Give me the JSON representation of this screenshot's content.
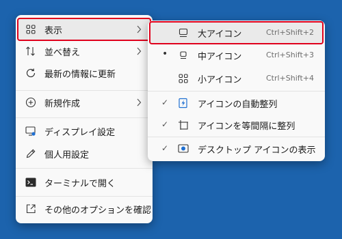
{
  "main_menu": {
    "items": [
      {
        "label": "表示",
        "icon": "grid-icon",
        "has_submenu": true
      },
      {
        "label": "並べ替え",
        "icon": "sort-icon",
        "has_submenu": true
      },
      {
        "label": "最新の情報に更新",
        "icon": "refresh-icon",
        "has_submenu": false
      },
      {
        "label": "新規作成",
        "icon": "add-circle-icon",
        "has_submenu": true
      },
      {
        "label": "ディスプレイ設定",
        "icon": "display-settings-icon",
        "has_submenu": false
      },
      {
        "label": "個人用設定",
        "icon": "pen-icon",
        "has_submenu": false
      },
      {
        "label": "ターミナルで開く",
        "icon": "terminal-icon",
        "has_submenu": false
      },
      {
        "label": "その他のオプションを確認",
        "icon": "open-external-icon",
        "has_submenu": false
      }
    ]
  },
  "sub_menu": {
    "items": [
      {
        "label": "大アイコン",
        "shortcut": "Ctrl+Shift+2",
        "mark": "",
        "icon": "large-icon"
      },
      {
        "label": "中アイコン",
        "shortcut": "Ctrl+Shift+3",
        "mark": "•",
        "icon": "medium-icon"
      },
      {
        "label": "小アイコン",
        "shortcut": "Ctrl+Shift+4",
        "mark": "",
        "icon": "small-icons-icon"
      },
      {
        "label": "アイコンの自動整列",
        "shortcut": "",
        "mark": "✓",
        "icon": "auto-arrange-icon"
      },
      {
        "label": "アイコンを等間隔に整列",
        "shortcut": "",
        "mark": "✓",
        "icon": "align-grid-icon"
      },
      {
        "label": "デスクトップ アイコンの表示",
        "shortcut": "",
        "mark": "✓",
        "icon": "show-desktop-icons-icon"
      }
    ]
  },
  "colors": {
    "desktop": "#1c63ad",
    "menu_bg": "#f9f9f9",
    "highlight_border": "#e0001b"
  }
}
